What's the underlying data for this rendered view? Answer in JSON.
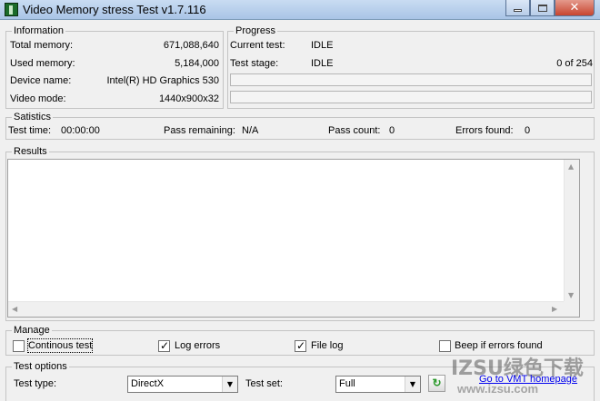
{
  "window": {
    "title": "Video Memory stress Test v1.7.116"
  },
  "information": {
    "legend": "Information",
    "rows": [
      {
        "label": "Total memory:",
        "value": "671,088,640"
      },
      {
        "label": "Used memory:",
        "value": "5,184,000"
      },
      {
        "label": "Device name:",
        "value": "Intel(R) HD Graphics 530"
      },
      {
        "label": "Video mode:",
        "value": "1440x900x32"
      }
    ]
  },
  "progress": {
    "legend": "Progress",
    "current_test_label": "Current test:",
    "current_test_value": "IDLE",
    "test_stage_label": "Test stage:",
    "test_stage_value": "IDLE",
    "stage_count": "0 of 254",
    "bar1_fraction": 0,
    "bar2_fraction": 0
  },
  "statistics": {
    "legend": "Satistics",
    "test_time_label": "Test time:",
    "test_time_value": "00:00:00",
    "pass_remaining_label": "Pass remaining:",
    "pass_remaining_value": "N/A",
    "pass_count_label": "Pass count:",
    "pass_count_value": "0",
    "errors_found_label": "Errors found:",
    "errors_found_value": "0"
  },
  "results": {
    "legend": "Results"
  },
  "manage": {
    "legend": "Manage",
    "continuous_test": {
      "label": "Continous test",
      "checked": false
    },
    "log_errors": {
      "label": "Log errors",
      "checked": true
    },
    "file_log": {
      "label": "File log",
      "checked": true
    },
    "beep_errors": {
      "label": "Beep if errors found",
      "checked": false
    }
  },
  "test_options": {
    "legend": "Test options",
    "test_type_label": "Test type:",
    "test_type_value": "DirectX",
    "test_set_label": "Test set:",
    "test_set_value": "Full",
    "homepage_link": "Go to VMT homepage"
  },
  "watermark": {
    "text": "IZSU绿色下载",
    "sub": "www.izsu.com"
  }
}
